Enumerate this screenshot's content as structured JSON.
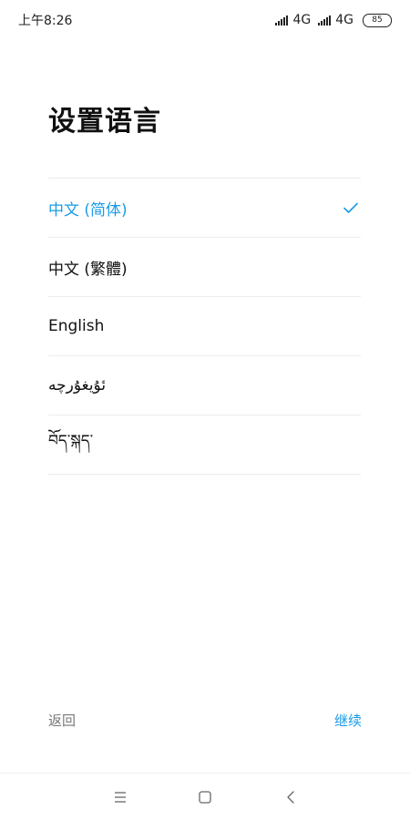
{
  "status_bar": {
    "time": "上午8:26",
    "network_1": "4G",
    "network_2": "4G",
    "battery": "85"
  },
  "title": "设置语言",
  "languages": [
    {
      "label": "中文 (简体)",
      "selected": true
    },
    {
      "label": "中文 (繁體)",
      "selected": false
    },
    {
      "label": "English",
      "selected": false
    },
    {
      "label": "ئۇيغۇرچە",
      "selected": false
    },
    {
      "label": "བོད་སྐད་",
      "selected": false
    }
  ],
  "actions": {
    "back_label": "返回",
    "continue_label": "继续"
  },
  "colors": {
    "accent": "#1a9be6",
    "secondary_text": "#777777",
    "divider": "#ececec"
  },
  "icons": {
    "selected": "check-icon",
    "nav_menu": "menu-icon",
    "nav_home": "home-icon",
    "nav_back": "back-arrow-icon"
  }
}
